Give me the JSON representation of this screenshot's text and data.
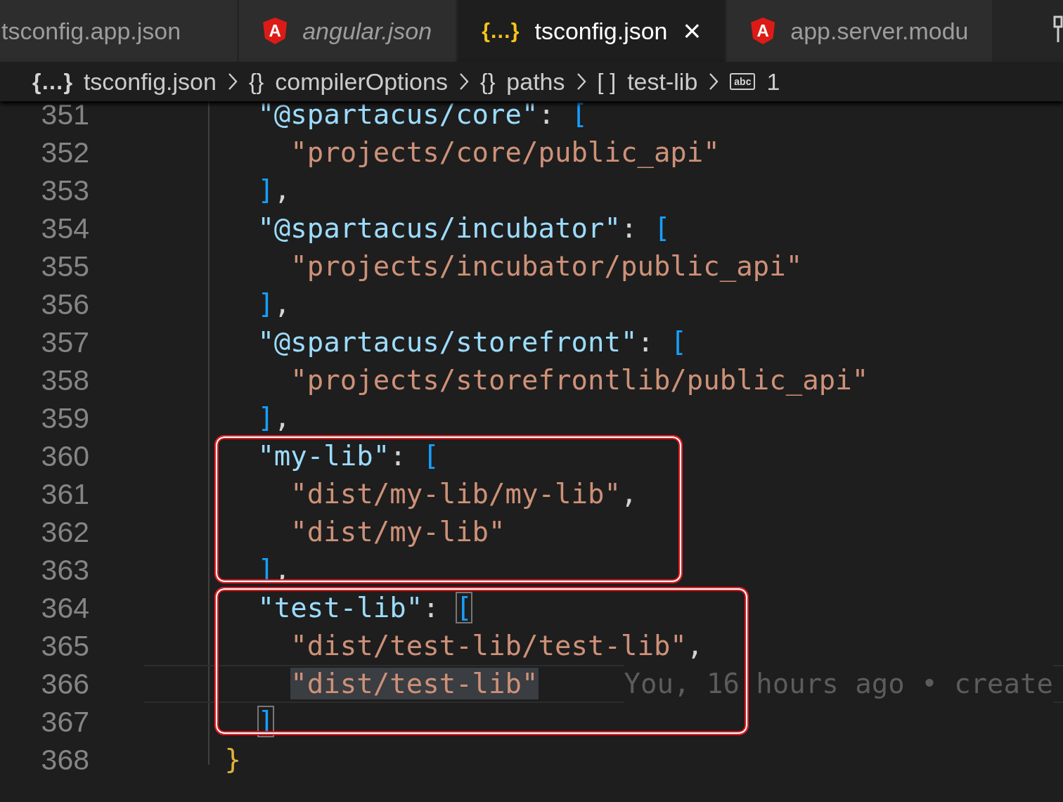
{
  "tabs": [
    {
      "label": "tsconfig.app.json",
      "selected": false,
      "preview": false
    },
    {
      "label": "angular.json",
      "icon": {
        "kind": "angular",
        "text": "A"
      },
      "selected": false,
      "preview": true
    },
    {
      "label": "tsconfig.json",
      "icon": {
        "kind": "json",
        "text": "{…}"
      },
      "selected": true,
      "preview": false,
      "close": "×"
    },
    {
      "label": "app.server.modu",
      "icon": {
        "kind": "angular",
        "text": "A"
      },
      "selected": false,
      "preview": false
    }
  ],
  "breadcrumbs": [
    {
      "kind": "json",
      "icon": "{…}",
      "label": "tsconfig.json"
    },
    {
      "kind": "object",
      "icon": "{}",
      "label": "compilerOptions"
    },
    {
      "kind": "object",
      "icon": "{}",
      "label": "paths"
    },
    {
      "kind": "array",
      "icon": "[ ]",
      "label": "test-lib"
    },
    {
      "kind": "string",
      "icon": "abc",
      "label": "1"
    }
  ],
  "blocks": [
    {
      "framed": false,
      "lines": [
        {
          "number": "351",
          "current": false,
          "tokens": [
            {
              "kind": "key",
              "text": "      \"@spartacus/core\""
            },
            {
              "kind": "punct",
              "text": ": "
            },
            {
              "kind": "bracket",
              "text": "[",
              "matched": false
            }
          ]
        },
        {
          "number": "352",
          "current": false,
          "tokens": [
            {
              "kind": "string",
              "text": "        \"projects/core/public_api\"",
              "selected": false
            }
          ]
        },
        {
          "number": "353",
          "current": false,
          "tokens": [
            {
              "kind": "bracket",
              "text": "      ]",
              "matched": false
            },
            {
              "kind": "punct",
              "text": ","
            }
          ]
        },
        {
          "number": "354",
          "current": false,
          "tokens": [
            {
              "kind": "key",
              "text": "      \"@spartacus/incubator\""
            },
            {
              "kind": "punct",
              "text": ": "
            },
            {
              "kind": "bracket",
              "text": "[",
              "matched": false
            }
          ]
        },
        {
          "number": "355",
          "current": false,
          "tokens": [
            {
              "kind": "string",
              "text": "        \"projects/incubator/public_api\"",
              "selected": false
            }
          ]
        },
        {
          "number": "356",
          "current": false,
          "tokens": [
            {
              "kind": "bracket",
              "text": "      ]",
              "matched": false
            },
            {
              "kind": "punct",
              "text": ","
            }
          ]
        },
        {
          "number": "357",
          "current": false,
          "tokens": [
            {
              "kind": "key",
              "text": "      \"@spartacus/storefront\""
            },
            {
              "kind": "punct",
              "text": ": "
            },
            {
              "kind": "bracket",
              "text": "[",
              "matched": false
            }
          ]
        },
        {
          "number": "358",
          "current": false,
          "tokens": [
            {
              "kind": "string",
              "text": "        \"projects/storefrontlib/public_api\"",
              "selected": false
            }
          ]
        },
        {
          "number": "359",
          "current": false,
          "tokens": [
            {
              "kind": "bracket",
              "text": "      ]",
              "matched": false
            },
            {
              "kind": "punct",
              "text": ","
            }
          ]
        }
      ]
    },
    {
      "framed": true,
      "lines": [
        {
          "number": "360",
          "current": false,
          "tokens": [
            {
              "kind": "key",
              "text": "      \"my-lib\""
            },
            {
              "kind": "punct",
              "text": ": "
            },
            {
              "kind": "bracket",
              "text": "[",
              "matched": false
            }
          ]
        },
        {
          "number": "361",
          "current": false,
          "tokens": [
            {
              "kind": "string",
              "text": "        \"dist/my-lib/my-lib\"",
              "selected": false
            },
            {
              "kind": "punct",
              "text": ","
            }
          ]
        },
        {
          "number": "362",
          "current": false,
          "tokens": [
            {
              "kind": "string",
              "text": "        \"dist/my-lib\"",
              "selected": false
            }
          ]
        },
        {
          "number": "363",
          "current": false,
          "tokens": [
            {
              "kind": "bracket",
              "text": "      ]",
              "matched": false
            },
            {
              "kind": "punct",
              "text": ","
            }
          ]
        }
      ]
    },
    {
      "framed": true,
      "lines": [
        {
          "number": "364",
          "current": false,
          "tokens": [
            {
              "kind": "key",
              "text": "      \"test-lib\""
            },
            {
              "kind": "punct",
              "text": ": "
            },
            {
              "kind": "bracket",
              "text": "[",
              "matched": true
            }
          ]
        },
        {
          "number": "365",
          "current": false,
          "tokens": [
            {
              "kind": "string",
              "text": "        \"dist/test-lib/test-lib\"",
              "selected": false
            },
            {
              "kind": "punct",
              "text": ","
            }
          ]
        },
        {
          "number": "366",
          "current": true,
          "blame": "You, 16 hours ago • create",
          "tokens": [
            {
              "kind": "string",
              "text": "        \"dist/test-lib\"",
              "selected": true
            }
          ]
        },
        {
          "number": "367",
          "current": false,
          "tokens": [
            {
              "kind": "bracket",
              "text": "      ]",
              "matched": true
            }
          ]
        }
      ]
    },
    {
      "framed": false,
      "lines": [
        {
          "number": "368",
          "current": false,
          "tokens": [
            {
              "kind": "brace",
              "text": "    }"
            }
          ]
        }
      ]
    }
  ]
}
